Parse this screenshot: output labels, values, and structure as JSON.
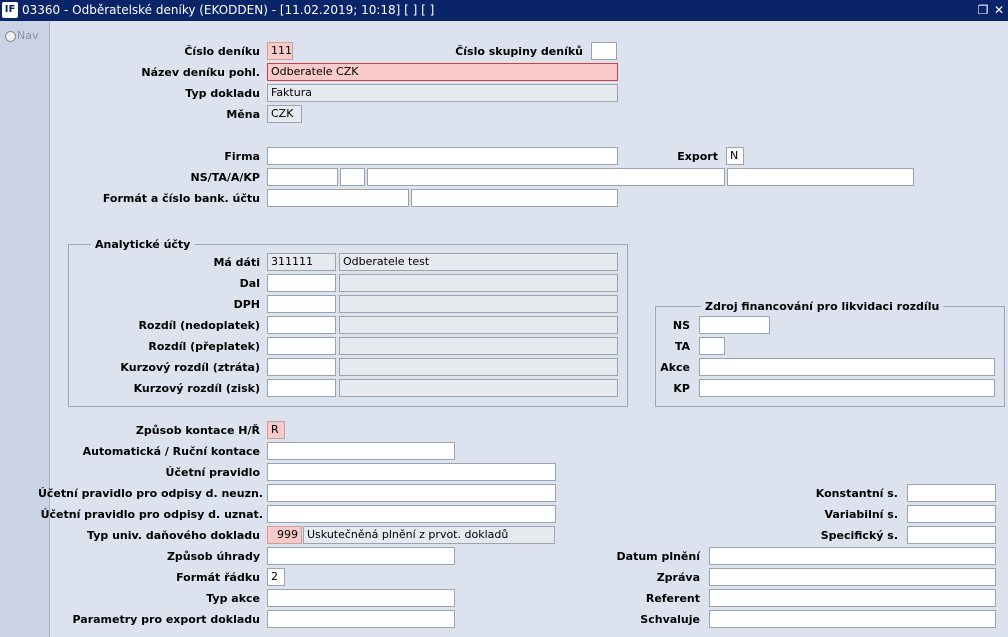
{
  "window": {
    "logo": "IF",
    "title": "03360 - Odběratelské deníky (EKODDEN) - [11.02.2019; 10:18]  [ ]  [ ]"
  },
  "nav": {
    "label": "Nav"
  },
  "header": {
    "cislo_deniku": {
      "label": "Číslo deníku",
      "value": "111"
    },
    "cislo_skupiny": {
      "label": "Číslo skupiny deníků",
      "value": ""
    },
    "nazev_deniku": {
      "label": "Název deníku pohl.",
      "value": "Odberatele CZK"
    },
    "typ_dokladu": {
      "label": "Typ dokladu",
      "value": "Faktura"
    },
    "mena": {
      "label": "Měna",
      "value": "CZK"
    }
  },
  "firma": {
    "label": "Firma",
    "value": ""
  },
  "export": {
    "label": "Export",
    "value": "N"
  },
  "ns_ta": {
    "label": "NS/TA/A/KP",
    "values": [
      "",
      "",
      "",
      ""
    ]
  },
  "bank": {
    "label": "Formát a číslo bank. účtu",
    "values": [
      "",
      ""
    ]
  },
  "analyticke": {
    "title": "Analytické účty",
    "rows": [
      {
        "label": "Má dáti",
        "code": "311111",
        "desc": "Odberatele test"
      },
      {
        "label": "Dal",
        "code": "",
        "desc": ""
      },
      {
        "label": "DPH",
        "code": "",
        "desc": ""
      },
      {
        "label": "Rozdíl (nedoplatek)",
        "code": "",
        "desc": ""
      },
      {
        "label": "Rozdíl (přeplatek)",
        "code": "",
        "desc": ""
      },
      {
        "label": "Kurzový rozdíl (ztráta)",
        "code": "",
        "desc": ""
      },
      {
        "label": "Kurzový rozdíl (zisk)",
        "code": "",
        "desc": ""
      }
    ]
  },
  "zdroj": {
    "title": "Zdroj financování pro likvidaci rozdílu",
    "ns": {
      "label": "NS",
      "value": ""
    },
    "ta": {
      "label": "TA",
      "value": ""
    },
    "akce": {
      "label": "Akce",
      "value": ""
    },
    "kp": {
      "label": "KP",
      "value": ""
    }
  },
  "bottom_left": {
    "zpusob_kontace": {
      "label": "Způsob kontace H/Ř",
      "value": "R"
    },
    "automaticka": {
      "label": "Automatická / Ruční kontace",
      "value": ""
    },
    "ucetni_pravidlo": {
      "label": "Účetní pravidlo",
      "value": ""
    },
    "pravidlo_neuzn": {
      "label": "Účetní pravidlo pro odpisy d. neuzn.",
      "value": ""
    },
    "pravidlo_uznat": {
      "label": "Účetní pravidlo pro odpisy d. uznat.",
      "value": ""
    },
    "typ_univ": {
      "label": "Typ univ. daňového dokladu",
      "code": "999",
      "desc": "Uskutečněná plnění z prvot. dokladů"
    },
    "zpusob_uhrady": {
      "label": "Způsob úhrady",
      "value": ""
    },
    "format_radku": {
      "label": "Formát řádku",
      "value": "2"
    },
    "typ_akce": {
      "label": "Typ akce",
      "value": ""
    },
    "parametry": {
      "label": "Parametry pro export dokladu",
      "value": ""
    }
  },
  "bottom_right": {
    "konstantni": {
      "label": "Konstantní s.",
      "value": ""
    },
    "variabilni": {
      "label": "Variabilní s.",
      "value": ""
    },
    "specificky": {
      "label": "Specifický s.",
      "value": ""
    },
    "datum_plneni": {
      "label": "Datum plnění",
      "value": ""
    },
    "zprava": {
      "label": "Zpráva",
      "value": ""
    },
    "referent": {
      "label": "Referent",
      "value": ""
    },
    "schvaluje": {
      "label": "Schvaluje",
      "value": ""
    }
  }
}
